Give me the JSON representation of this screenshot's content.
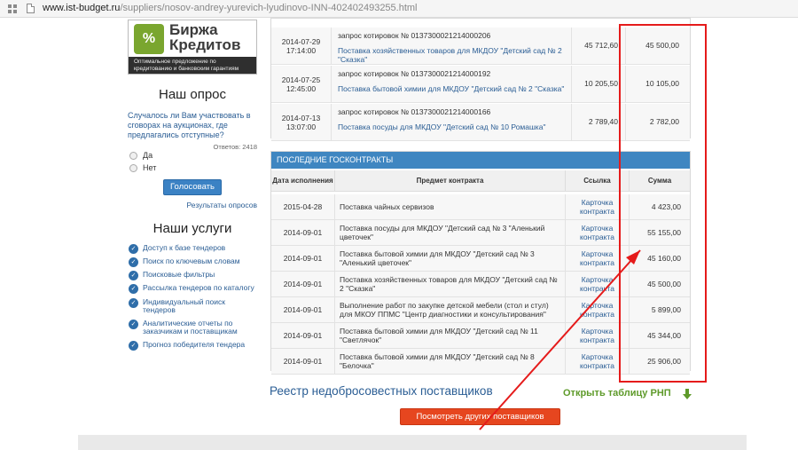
{
  "browser": {
    "url_domain": "www.ist-budget.ru",
    "url_path": "/suppliers/nosov-andrey-yurevich-lyudinovo-INN-402402493255.html"
  },
  "banner": {
    "logo_text": "%",
    "title_line1": "Биржа",
    "title_line2": "Кредитов",
    "tagline": "Оптимальное предложение по кредитованию и банковским гарантиям"
  },
  "poll": {
    "title": "Наш опрос",
    "question": "Случалось ли Вам участвовать в сговорах на аукционах, где предлагались отступные?",
    "answers_count": "Ответов: 2418",
    "options": [
      "Да",
      "Нет"
    ],
    "vote_label": "Голосовать",
    "results_label": "Результаты опросов"
  },
  "services": {
    "title": "Наши услуги",
    "items": [
      "Доступ к базе тендеров",
      "Поиск по ключевым словам",
      "Поисковые фильтры",
      "Рассылка тендеров по каталогу",
      "Индивидуальный поиск тендеров",
      "Аналитические отчеты по заказчикам и поставщикам",
      "Прогноз победителя тендера"
    ]
  },
  "tenders": [
    {
      "date": "2014-07-29",
      "time": "17:14:00",
      "kind": "запрос котировок № 0137300021214000206",
      "subject": "Поставка хозяйственных товаров для МКДОУ \"Детский сад № 2 \"Сказка\"",
      "price1": "45 712,60",
      "price2": "45 500,00"
    },
    {
      "date": "2014-07-25",
      "time": "12:45:00",
      "kind": "запрос котировок № 0137300021214000192",
      "subject": "Поставка бытовой химии для МКДОУ \"Детский сад № 2 \"Сказка\"",
      "price1": "10 205,50",
      "price2": "10 105,00"
    },
    {
      "date": "2014-07-13",
      "time": "13:07:00",
      "kind": "запрос котировок № 0137300021214000166",
      "subject": "Поставка посуды для МКДОУ \"Детский сад № 10 Ромашка\"",
      "price1": "2 789,40",
      "price2": "2 782,00"
    }
  ],
  "contracts": {
    "title": "ПОСЛЕДНИЕ ГОСКОНТРАКТЫ",
    "headers": {
      "date": "Дата исполнения",
      "subject": "Предмет контракта",
      "link": "Ссылка",
      "sum": "Сумма"
    },
    "rows": [
      {
        "date": "2015-04-28",
        "subject": "Поставка чайных сервизов",
        "link": "Карточка контракта",
        "sum": "4 423,00"
      },
      {
        "date": "2014-09-01",
        "subject": "Поставка посуды для МКДОУ \"Детский сад № 3 \"Аленький цветочек\"",
        "link": "Карточка контракта",
        "sum": "55 155,00"
      },
      {
        "date": "2014-09-01",
        "subject": "Поставка бытовой химии для МКДОУ \"Детский сад № 3 \"Аленький цветочек\"",
        "link": "Карточка контракта",
        "sum": "45 160,00"
      },
      {
        "date": "2014-09-01",
        "subject": "Поставка хозяйственных товаров для МКДОУ \"Детский сад № 2 \"Сказка\"",
        "link": "Карточка контракта",
        "sum": "45 500,00"
      },
      {
        "date": "2014-09-01",
        "subject": "Выполнение работ по закупке детской мебели (стол и стул) для МКОУ ППМС \"Центр диагностики и консультирования\"",
        "link": "Карточка контракта",
        "sum": "5 899,00"
      },
      {
        "date": "2014-09-01",
        "subject": "Поставка бытовой химии для МКДОУ \"Детский сад № 11 \"Светлячок\"",
        "link": "Карточка контракта",
        "sum": "45 344,00"
      },
      {
        "date": "2014-09-01",
        "subject": "Поставка бытовой химии для МКДОУ \"Детский сад № 8 \"Белочка\"",
        "link": "Карточка контракта",
        "sum": "25 906,00"
      }
    ]
  },
  "rnp": {
    "title": "Реестр недобросовестных поставщиков",
    "open_link": "Открыть таблицу РНП",
    "more_button": "Посмотреть других поставщиков"
  },
  "colors": {
    "header_blue": "#3f86c1",
    "link_blue": "#2a5d94",
    "button_blue": "#3b82c4",
    "button_orange": "#e6461f",
    "rnp_green": "#5e9a2a",
    "annotation_red": "#e51b1b"
  }
}
